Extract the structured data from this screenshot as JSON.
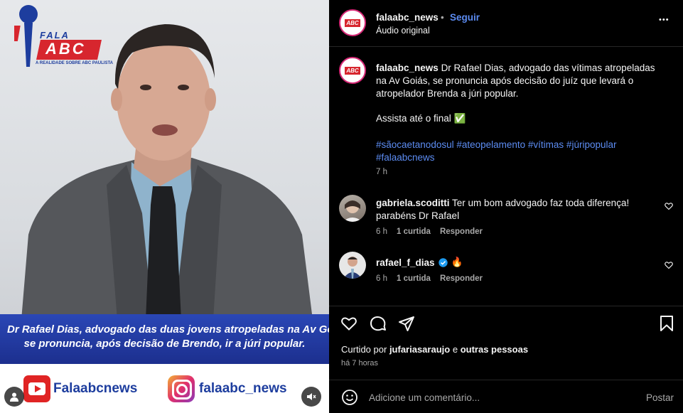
{
  "video": {
    "logo": {
      "top_word": "FALA",
      "main_word": "ABC",
      "tagline": "A REALIDADE SOBRE ABC PAULISTA"
    },
    "caption_line1": "Dr Rafael Dias, advogado das duas jovens atropeladas na Av Goiás,",
    "caption_line2": "se pronuncia, após decisão de Brendo, ir a júri popular.",
    "youtube_handle": "Falaabcnews",
    "instagram_handle": "falaabc_news"
  },
  "header": {
    "username": "falaabc_news",
    "separator": "•",
    "follow_label": "Seguir",
    "audio_label": "Áudio original",
    "more_label": "•••"
  },
  "post": {
    "username": "falaabc_news",
    "caption": "Dr Rafael Dias, advogado das vítimas atropeladas na Av Goiás, se pronuncia após decisão do juíz que levará o atropelador Brenda a júri popular.",
    "line2": "Assista até o final",
    "check_emoji": "✅",
    "hashtags": "#sãocaetanodosul #ateopelamento #vítimas #júripopular #falaabcnews",
    "time": "7 h"
  },
  "comments": [
    {
      "username": "gabriela.scoditti",
      "text": "Ter um bom advogado faz toda diferença! parabéns Dr Rafael",
      "time": "6 h",
      "likes": "1 curtida",
      "reply": "Responder"
    },
    {
      "username": "rafael_f_dias",
      "text": "🔥",
      "time": "6 h",
      "likes": "1 curtida",
      "reply": "Responder"
    }
  ],
  "likes": {
    "prefix": "Curtido por",
    "user": "jufariasaraujo",
    "conj": "e",
    "others": "outras pessoas",
    "time": "há 7 horas"
  },
  "add_comment": {
    "placeholder": "Adicione um comentário...",
    "post_label": "Postar"
  },
  "colors": {
    "accent": "#0095f6",
    "link": "#5c8cf2",
    "brand_blue": "#1d3d9e",
    "brand_red": "#d7262e"
  }
}
